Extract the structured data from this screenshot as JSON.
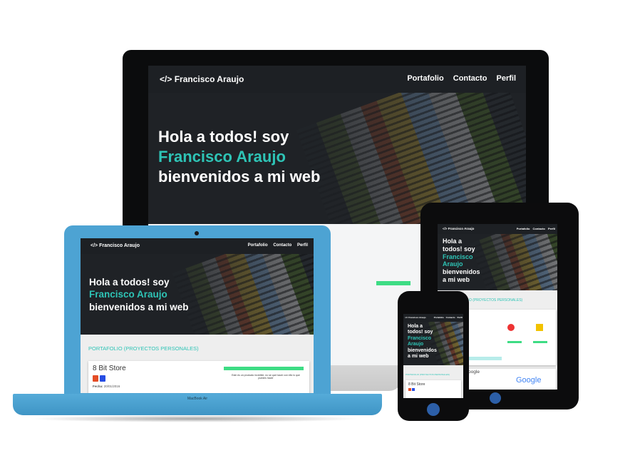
{
  "site": {
    "brand_mark": "</>",
    "brand_name": "Francisco Araujo",
    "nav": [
      "Portafolio",
      "Contacto",
      "Perfil"
    ],
    "hero": {
      "line1": "Hola a todos! soy",
      "name": "Francisco Araujo",
      "line3": "bienvenidos a mi web",
      "phone_line1a": "Hola a",
      "phone_line1b": "todos! soy",
      "tablet_name_a": "Francisco",
      "tablet_name_b": "Araujo",
      "phone_line3a": "bienvenidos",
      "phone_line3b": "a mi web"
    },
    "portfolio_title": "PORTAFOLIO (PROYECTOS PERSONALES)",
    "tablet_portfolio_title": "O (PROYECTOS PERSONALES)",
    "project": {
      "title": "8 Bit Store",
      "date_label": "Fecha:",
      "date_value": "20/01/2016",
      "desc": "Este es un producto increible, no se que hacer con ello lo que puedes hacer"
    },
    "tablet_google_title": "Google",
    "google_logo": "Google"
  },
  "laptop_label": "MacBook Air",
  "colors": {
    "accent": "#2ec4b6",
    "laptop_blue": "#4da3d3",
    "dark_bg": "#1f2226",
    "green_bar": "#3ddc84"
  },
  "icons": [
    "apple-logo-icon",
    "html5-icon",
    "css3-icon",
    "camera-icon",
    "home-button-icon"
  ]
}
